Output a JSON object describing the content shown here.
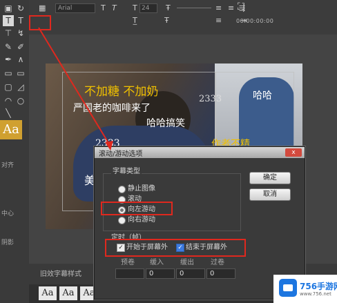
{
  "toolbar": {
    "font_name": "Arial",
    "size_value": "24",
    "timecode": "00:00:00:00"
  },
  "left_panel": {
    "aa_sample": "Aa",
    "section_labels": [
      "对齐",
      "中心",
      "阴影"
    ]
  },
  "video": {
    "overlay_texts": [
      "不加糖 不加奶",
      "严国老的咖啡来了",
      "哈哈搞笑",
      "哈哈",
      "2333",
      "2333",
      "作者不精",
      "美"
    ]
  },
  "bottom": {
    "styles_label": "旧效字幕样式",
    "aa_tiles": [
      "Aa",
      "Aa",
      "Aa"
    ]
  },
  "dialog": {
    "title": "滚动/游动选项",
    "close_label": "x",
    "subtitle_type_label": "字幕类型",
    "options": [
      "静止图像",
      "滚动",
      "向左游动",
      "向右游动"
    ],
    "selected_index": 2,
    "ok_label": "确定",
    "cancel_label": "取消",
    "timing_label": "定时（帧）",
    "start_offscreen": "开始于屏幕外",
    "end_offscreen": "结束于屏幕外",
    "start_checked": true,
    "end_checked": true,
    "fields": [
      {
        "label": "预卷",
        "value": ""
      },
      {
        "label": "缓入",
        "value": "0"
      },
      {
        "label": "缓出",
        "value": "0"
      },
      {
        "label": "过卷",
        "value": "0"
      }
    ]
  },
  "watermark": {
    "text": "756手游网",
    "url": "www.756.net"
  }
}
